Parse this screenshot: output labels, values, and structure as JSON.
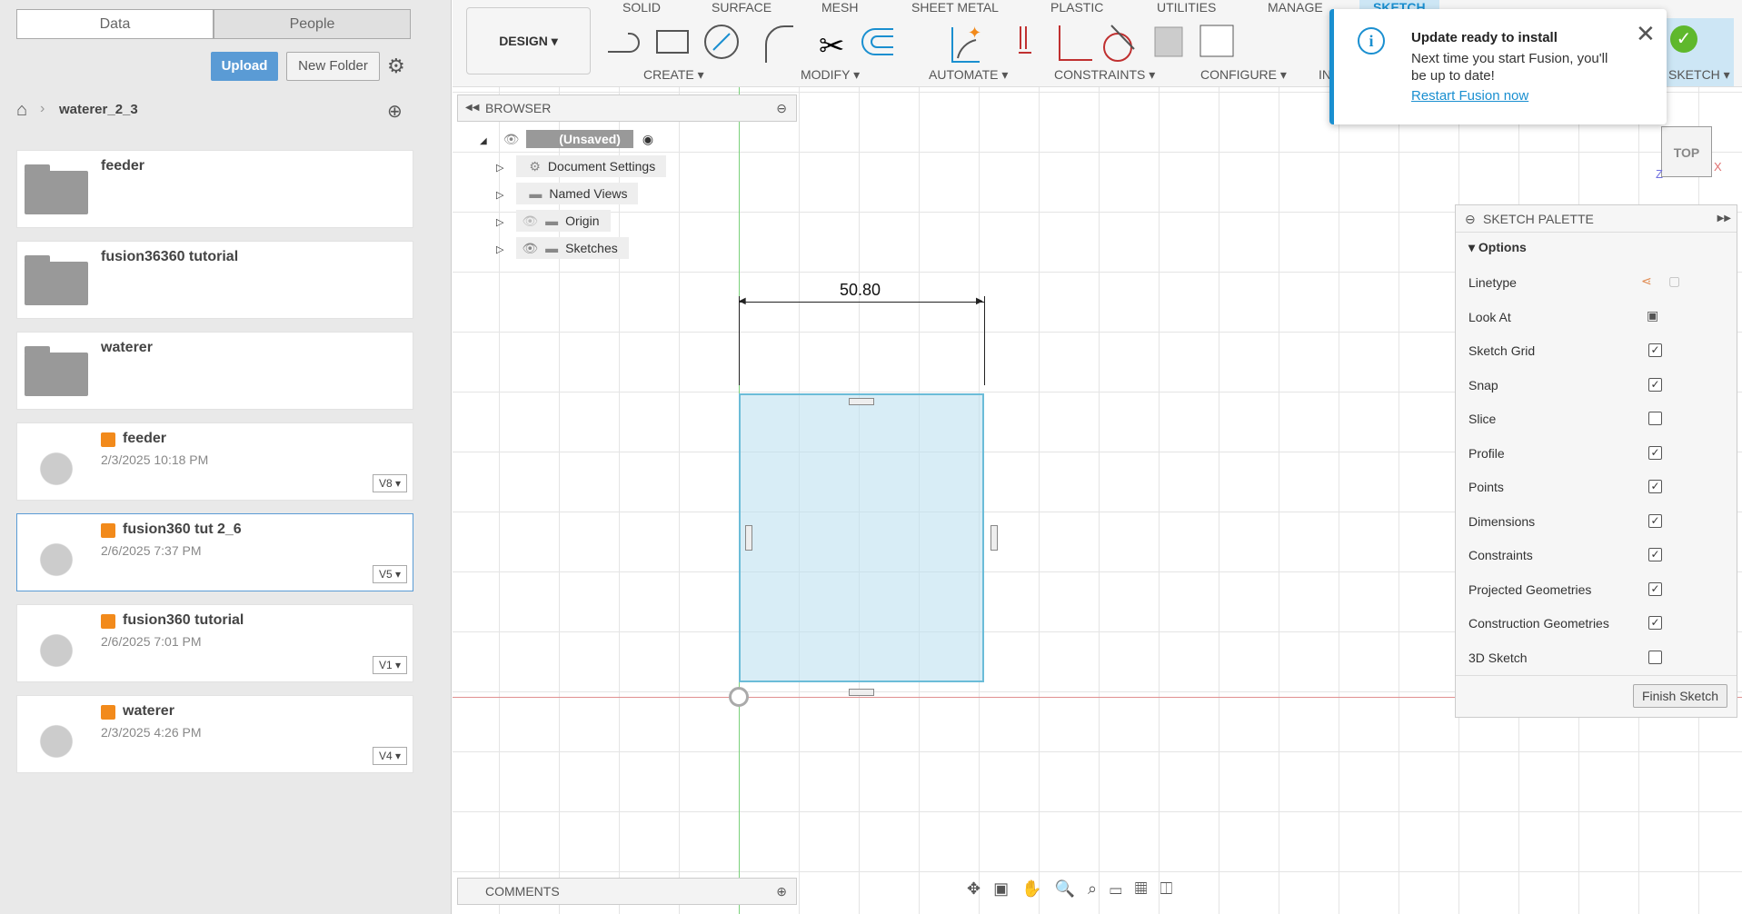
{
  "left": {
    "tabs": [
      "Data",
      "People"
    ],
    "upload": "Upload",
    "new_folder": "New Folder",
    "breadcrumb": "waterer_2_3",
    "items": [
      {
        "name": "feeder",
        "type": "folder"
      },
      {
        "name": "fusion36360 tutorial",
        "type": "folder"
      },
      {
        "name": "waterer",
        "type": "folder"
      },
      {
        "name": "feeder",
        "type": "design",
        "date": "2/3/2025 10:18 PM",
        "version": "V8"
      },
      {
        "name": "fusion360 tut 2_6",
        "type": "design",
        "date": "2/6/2025 7:37 PM",
        "version": "V5"
      },
      {
        "name": "fusion360 tutorial",
        "type": "design",
        "date": "2/6/2025 7:01 PM",
        "version": "V1"
      },
      {
        "name": "waterer",
        "type": "design",
        "date": "2/3/2025 4:26 PM",
        "version": "V4"
      }
    ]
  },
  "toolbar": {
    "workspace": "DESIGN",
    "tabs": [
      "SOLID",
      "SURFACE",
      "MESH",
      "SHEET METAL",
      "PLASTIC",
      "UTILITIES",
      "MANAGE",
      "SKETCH"
    ],
    "groups": [
      "CREATE",
      "MODIFY",
      "AUTOMATE",
      "CONSTRAINTS",
      "CONFIGURE",
      "IN",
      "SKETCH"
    ]
  },
  "notification": {
    "title": "Update ready to install",
    "body": "Next time you start Fusion, you'll be up to date!",
    "link": "Restart Fusion now"
  },
  "browser": {
    "title": "BROWSER",
    "root": "(Unsaved)",
    "nodes": [
      "Document Settings",
      "Named Views",
      "Origin",
      "Sketches"
    ]
  },
  "sketch": {
    "dimension": "50.80"
  },
  "viewcube": {
    "face": "TOP",
    "x": "X",
    "z": "Z"
  },
  "palette": {
    "title": "SKETCH PALETTE",
    "section": "Options",
    "finish": "Finish Sketch",
    "rows": [
      {
        "label": "Linetype"
      },
      {
        "label": "Look At"
      },
      {
        "label": "Sketch Grid",
        "checked": true
      },
      {
        "label": "Snap",
        "checked": true
      },
      {
        "label": "Slice",
        "checked": false
      },
      {
        "label": "Profile",
        "checked": true
      },
      {
        "label": "Points",
        "checked": true
      },
      {
        "label": "Dimensions",
        "checked": true
      },
      {
        "label": "Constraints",
        "checked": true
      },
      {
        "label": "Projected Geometries",
        "checked": true
      },
      {
        "label": "Construction Geometries",
        "checked": true
      },
      {
        "label": "3D Sketch",
        "checked": false
      }
    ]
  },
  "comments": {
    "title": "COMMENTS"
  }
}
